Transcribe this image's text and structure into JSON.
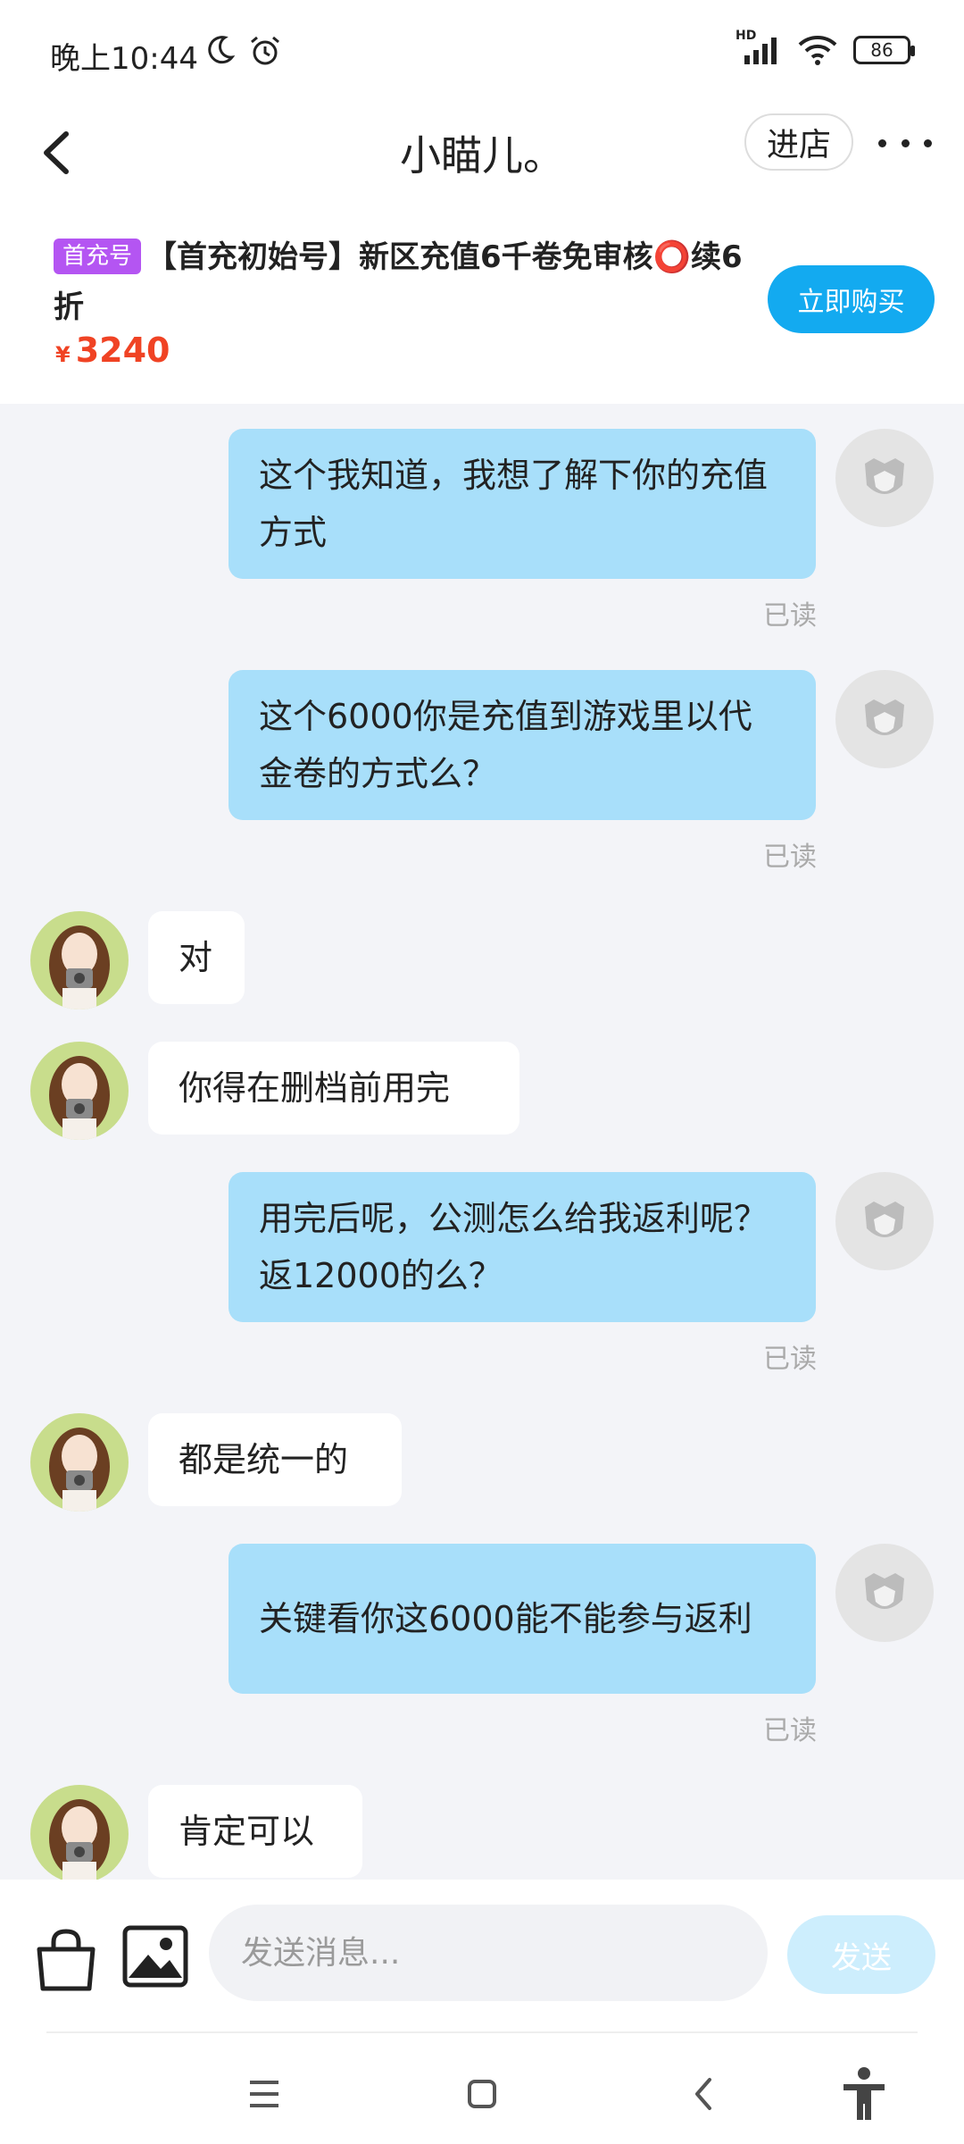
{
  "status_bar": {
    "time": "晚上10:44",
    "network": "HD",
    "battery": "86"
  },
  "header": {
    "title": "小瞄儿。",
    "shop_label": "进店"
  },
  "product": {
    "tag": "首充号",
    "title": "【首充初始号】新区充值6千卷免审核⭕续6折",
    "price_symbol": "¥",
    "price": "3240",
    "buy_label": "立即购买"
  },
  "messages": [
    {
      "side": "out",
      "text": "这个我知道，我想了解下你的充值方式",
      "status": "已读"
    },
    {
      "side": "out",
      "text": "这个6000你是充值到游戏里以代金卷的方式么？",
      "status": "已读"
    },
    {
      "side": "in",
      "text": "对"
    },
    {
      "side": "in",
      "text": "你得在删档前用完"
    },
    {
      "side": "out",
      "text": "用完后呢，公测怎么给我返利呢？返12000的么？",
      "status": "已读"
    },
    {
      "side": "in",
      "text": "都是统一的"
    },
    {
      "side": "out",
      "text": "关键看你这6000能不能参与返利",
      "status": "已读"
    },
    {
      "side": "in",
      "text": "肯定可以"
    }
  ],
  "composer": {
    "placeholder": "发送消息...",
    "send_label": "发送"
  },
  "colors": {
    "accent": "#13aaf0",
    "outgoing_bubble": "#a8dffa",
    "price": "#f04324",
    "tag": "#b455f2"
  }
}
